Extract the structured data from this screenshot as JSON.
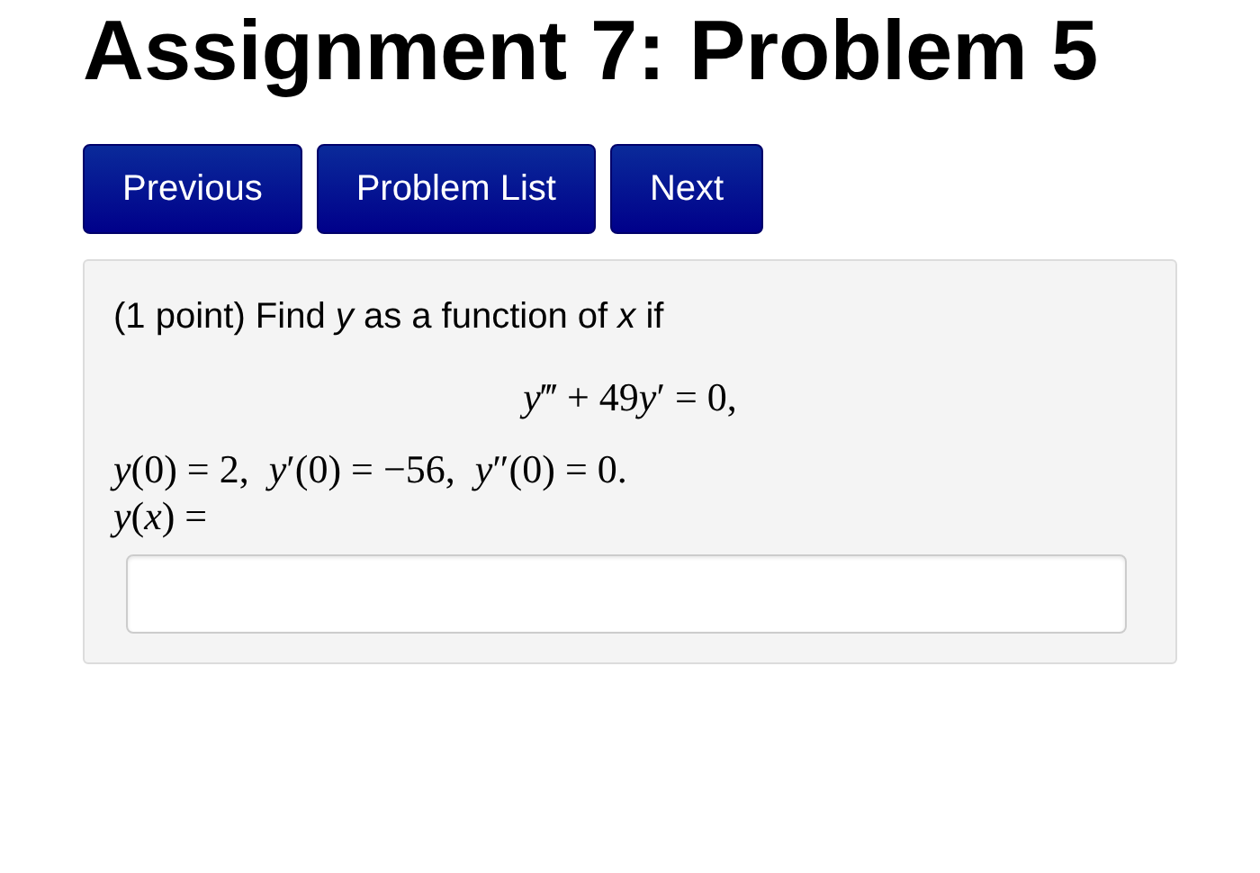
{
  "page_title": "Assignment 7: Problem 5",
  "nav_buttons": [
    {
      "label": "Previous"
    },
    {
      "label": "Problem List"
    },
    {
      "label": "Next"
    }
  ],
  "problem": {
    "intro": "(1 point) Find *y* as a function of *x* if",
    "equation": [
      "*y*‴ + 49",
      "*y*′ = 0,"
    ],
    "conditions": "*y*(0) = 2,  *y*′(0) = −56,  *y*″(0) = 0.",
    "answer_label": "*y*(*x*) ="
  }
}
